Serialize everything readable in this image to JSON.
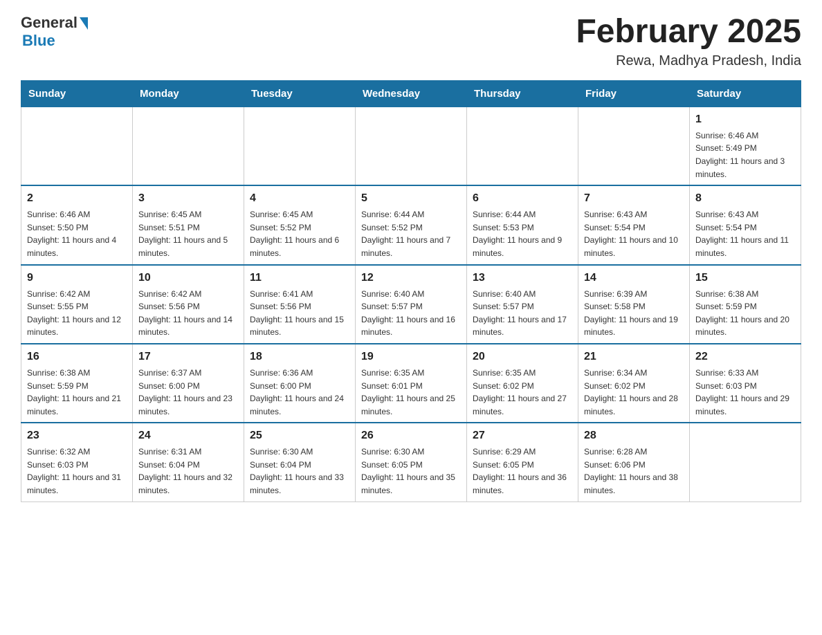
{
  "logo": {
    "general": "General",
    "blue": "Blue"
  },
  "title": "February 2025",
  "location": "Rewa, Madhya Pradesh, India",
  "days_of_week": [
    "Sunday",
    "Monday",
    "Tuesday",
    "Wednesday",
    "Thursday",
    "Friday",
    "Saturday"
  ],
  "weeks": [
    [
      {
        "day": "",
        "info": ""
      },
      {
        "day": "",
        "info": ""
      },
      {
        "day": "",
        "info": ""
      },
      {
        "day": "",
        "info": ""
      },
      {
        "day": "",
        "info": ""
      },
      {
        "day": "",
        "info": ""
      },
      {
        "day": "1",
        "info": "Sunrise: 6:46 AM\nSunset: 5:49 PM\nDaylight: 11 hours and 3 minutes."
      }
    ],
    [
      {
        "day": "2",
        "info": "Sunrise: 6:46 AM\nSunset: 5:50 PM\nDaylight: 11 hours and 4 minutes."
      },
      {
        "day": "3",
        "info": "Sunrise: 6:45 AM\nSunset: 5:51 PM\nDaylight: 11 hours and 5 minutes."
      },
      {
        "day": "4",
        "info": "Sunrise: 6:45 AM\nSunset: 5:52 PM\nDaylight: 11 hours and 6 minutes."
      },
      {
        "day": "5",
        "info": "Sunrise: 6:44 AM\nSunset: 5:52 PM\nDaylight: 11 hours and 7 minutes."
      },
      {
        "day": "6",
        "info": "Sunrise: 6:44 AM\nSunset: 5:53 PM\nDaylight: 11 hours and 9 minutes."
      },
      {
        "day": "7",
        "info": "Sunrise: 6:43 AM\nSunset: 5:54 PM\nDaylight: 11 hours and 10 minutes."
      },
      {
        "day": "8",
        "info": "Sunrise: 6:43 AM\nSunset: 5:54 PM\nDaylight: 11 hours and 11 minutes."
      }
    ],
    [
      {
        "day": "9",
        "info": "Sunrise: 6:42 AM\nSunset: 5:55 PM\nDaylight: 11 hours and 12 minutes."
      },
      {
        "day": "10",
        "info": "Sunrise: 6:42 AM\nSunset: 5:56 PM\nDaylight: 11 hours and 14 minutes."
      },
      {
        "day": "11",
        "info": "Sunrise: 6:41 AM\nSunset: 5:56 PM\nDaylight: 11 hours and 15 minutes."
      },
      {
        "day": "12",
        "info": "Sunrise: 6:40 AM\nSunset: 5:57 PM\nDaylight: 11 hours and 16 minutes."
      },
      {
        "day": "13",
        "info": "Sunrise: 6:40 AM\nSunset: 5:57 PM\nDaylight: 11 hours and 17 minutes."
      },
      {
        "day": "14",
        "info": "Sunrise: 6:39 AM\nSunset: 5:58 PM\nDaylight: 11 hours and 19 minutes."
      },
      {
        "day": "15",
        "info": "Sunrise: 6:38 AM\nSunset: 5:59 PM\nDaylight: 11 hours and 20 minutes."
      }
    ],
    [
      {
        "day": "16",
        "info": "Sunrise: 6:38 AM\nSunset: 5:59 PM\nDaylight: 11 hours and 21 minutes."
      },
      {
        "day": "17",
        "info": "Sunrise: 6:37 AM\nSunset: 6:00 PM\nDaylight: 11 hours and 23 minutes."
      },
      {
        "day": "18",
        "info": "Sunrise: 6:36 AM\nSunset: 6:00 PM\nDaylight: 11 hours and 24 minutes."
      },
      {
        "day": "19",
        "info": "Sunrise: 6:35 AM\nSunset: 6:01 PM\nDaylight: 11 hours and 25 minutes."
      },
      {
        "day": "20",
        "info": "Sunrise: 6:35 AM\nSunset: 6:02 PM\nDaylight: 11 hours and 27 minutes."
      },
      {
        "day": "21",
        "info": "Sunrise: 6:34 AM\nSunset: 6:02 PM\nDaylight: 11 hours and 28 minutes."
      },
      {
        "day": "22",
        "info": "Sunrise: 6:33 AM\nSunset: 6:03 PM\nDaylight: 11 hours and 29 minutes."
      }
    ],
    [
      {
        "day": "23",
        "info": "Sunrise: 6:32 AM\nSunset: 6:03 PM\nDaylight: 11 hours and 31 minutes."
      },
      {
        "day": "24",
        "info": "Sunrise: 6:31 AM\nSunset: 6:04 PM\nDaylight: 11 hours and 32 minutes."
      },
      {
        "day": "25",
        "info": "Sunrise: 6:30 AM\nSunset: 6:04 PM\nDaylight: 11 hours and 33 minutes."
      },
      {
        "day": "26",
        "info": "Sunrise: 6:30 AM\nSunset: 6:05 PM\nDaylight: 11 hours and 35 minutes."
      },
      {
        "day": "27",
        "info": "Sunrise: 6:29 AM\nSunset: 6:05 PM\nDaylight: 11 hours and 36 minutes."
      },
      {
        "day": "28",
        "info": "Sunrise: 6:28 AM\nSunset: 6:06 PM\nDaylight: 11 hours and 38 minutes."
      },
      {
        "day": "",
        "info": ""
      }
    ]
  ]
}
